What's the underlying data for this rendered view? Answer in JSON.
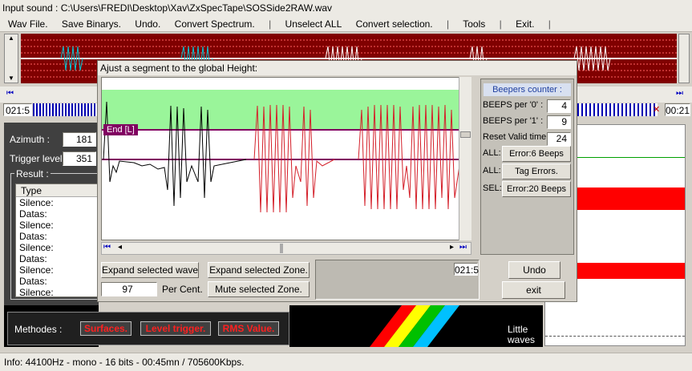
{
  "window": {
    "title": "Input sound : C:\\Users\\FREDI\\Desktop\\Xav\\ZxSpecTape\\SOSSide2RAW.wav"
  },
  "menu": {
    "wav_file": "Wav File.",
    "save_binaries": "Save Binarys.",
    "undo": "Undo.",
    "convert_spectrum": "Convert Spectrum.",
    "sep": "|",
    "unselect_all": "Unselect ALL",
    "convert_selection": "Convert selection.",
    "tools": "Tools",
    "exit": "Exit."
  },
  "timeline": {
    "left_time": "021:5",
    "right_time": "00:21"
  },
  "left_panel": {
    "azimuth_label": "Azimuth :",
    "azimuth_value": "181",
    "trigger_label": "Trigger level :",
    "trigger_value": "351",
    "result_label": "Result :",
    "type_header": "Type",
    "rows": [
      "Silence:",
      "Datas:",
      "Silence:",
      "Datas:",
      "Silence:",
      "Datas:",
      "Silence:",
      "Datas:",
      "Silence:"
    ],
    "methodes_label": "Methodes :",
    "surfaces": "Surfaces.",
    "level_trigger": "Level trigger.",
    "rms_value": "RMS Value."
  },
  "dialog": {
    "title": "Ajust a segment to the global Height:",
    "end_marker": "End [L]",
    "beepers_title": "Beepers counter :",
    "beeps0_label": "BEEPS per '0' :",
    "beeps0_value": "4",
    "beeps1_label": "BEEPS per '1' :",
    "beeps1_value": "9",
    "reset_label": "Reset Valid time:",
    "reset_value": "24",
    "all1": "ALL:",
    "error_beeps": "Error:6 Beeps",
    "all2": "ALL:",
    "tag_errors": "Tag Errors.",
    "sel": "SEL:",
    "error20": "Error:20 Beeps",
    "expand_waves": "Expand selected waves.",
    "expand_zone": "Expand selected Zone.",
    "percent_value": "97",
    "percent_label": "Per Cent.",
    "mute_zone": "Mute selected Zone.",
    "time_value": "021:5",
    "undo": "Undo",
    "exit": "exit"
  },
  "little_waves": "Little waves _",
  "status": {
    "info": "Info: 44100Hz - mono - 16 bits - 00:45mn / 705600Kbps."
  },
  "colors": {
    "green_band": "#9af59a",
    "red_wave": "#d4202a",
    "dark_wave": "#000000",
    "purple_line": "#800060",
    "red_band": "#ff0000",
    "cyan_wave": "#00c8d8"
  }
}
